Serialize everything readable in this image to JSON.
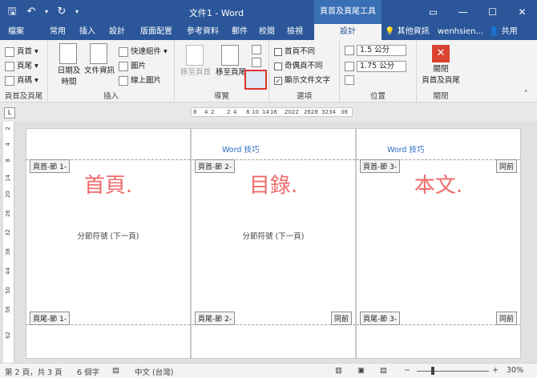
{
  "titlebar": {
    "doc_title": "文件1 - Word",
    "context_title": "頁首及頁尾工具",
    "qat": {
      "save_icon": "save-icon",
      "undo_icon": "undo-icon",
      "redo_icon": "redo-icon"
    },
    "controls": {
      "ribbon_display": "▭",
      "minimize": "—",
      "maximize": "☐",
      "close": "✕"
    }
  },
  "tabs": [
    "檔案",
    "常用",
    "插入",
    "設計",
    "版面配置",
    "參考資料",
    "郵件",
    "校閱",
    "檢視",
    "設計"
  ],
  "active_tab_index": 9,
  "tellme": "其他資訊",
  "user": "wenhsien...",
  "share": "共用",
  "ribbon": {
    "hf_group": {
      "header": "頁首 ▾",
      "footer": "頁尾 ▾",
      "page_number": "頁碼 ▾",
      "label": "頁首及頁尾"
    },
    "insert_group": {
      "date_time": "日期及\n時間",
      "doc_info": "文件資訊",
      "quick_parts": "快速組件 ▾",
      "pictures": "圖片",
      "online_pictures": "線上圖片",
      "label": "插入"
    },
    "nav_group": {
      "goto_header": "移至頁首",
      "goto_footer": "移至頁尾",
      "label": "導覽"
    },
    "options_group": {
      "different_first": "首頁不同",
      "different_odd_even": "奇偶頁不同",
      "show_doc_text": "顯示文件文字",
      "label": "選項"
    },
    "position_group": {
      "header_pos": "1.5 公分",
      "footer_pos": "1.75 公分",
      "label": "位置"
    },
    "close_group": {
      "close_label": "關閉\n頁首及頁尾",
      "label": "關閉"
    }
  },
  "ruler": {
    "ticks": [
      "8",
      "4",
      "2",
      "2",
      "4",
      "8",
      "10",
      "14",
      "16",
      "2022",
      "2628",
      "3234",
      "38"
    ]
  },
  "vruler": {
    "ticks": [
      "2",
      "2",
      "4",
      "10",
      "8",
      "16",
      "14",
      "22",
      "20",
      "28",
      "26",
      "34",
      "32",
      "40",
      "38",
      "46",
      "44",
      "52",
      "50",
      "58",
      "56",
      "64",
      "62"
    ]
  },
  "pages": [
    {
      "big_text": "首頁.",
      "header_tag": "頁首-節 1-",
      "footer_tag": "頁尾-節 1-",
      "section_break": "分節符號 (下一頁)",
      "header_text": ""
    },
    {
      "big_text": "目錄.",
      "header_tag": "頁首-節 2-",
      "footer_tag": "頁尾-節 2-",
      "section_break": "分節符號 (下一頁)",
      "header_text": "Word 技巧",
      "footer_same": "同前"
    },
    {
      "big_text": "本文.",
      "header_tag": "頁首-節 3-",
      "footer_tag": "頁尾-節 3-",
      "header_text": "Word 技巧",
      "header_same": "同前",
      "footer_same": "同前"
    }
  ],
  "statusbar": {
    "page": "第 2 頁，共 3 頁",
    "words": "6 個字",
    "lang": "中文 (台灣)",
    "zoom": "30%"
  }
}
